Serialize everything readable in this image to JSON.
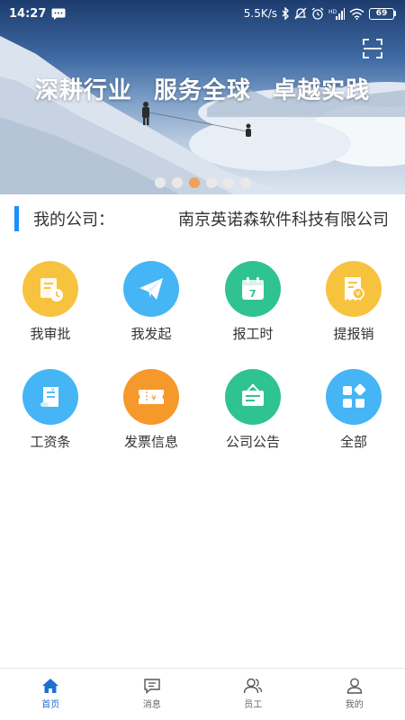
{
  "status_bar": {
    "time": "14:27",
    "net_speed": "5.5K/s",
    "battery": "69",
    "icons": [
      "message-icon",
      "bluetooth-icon",
      "mute-icon",
      "alarm-icon",
      "signal-icon",
      "wifi-icon",
      "battery-icon"
    ]
  },
  "banner": {
    "slogan": [
      "深耕行业",
      "服务全球",
      "卓越实践"
    ],
    "scan_icon": "scan-icon",
    "dot_count": 6,
    "active_dot": 2,
    "colors": {
      "active_dot": "#f2a154",
      "inactive_dot": "#e9e9e9"
    }
  },
  "company": {
    "label": "我的公司：",
    "name": "南京英诺森软件科技有限公司",
    "accent": "#1890ff"
  },
  "grid": [
    {
      "label": "我审批",
      "icon": "approval-stamp-icon",
      "color": "#f7c33f"
    },
    {
      "label": "我发起",
      "icon": "paper-plane-icon",
      "color": "#45b5f5"
    },
    {
      "label": "报工时",
      "icon": "calendar-icon",
      "color": "#2fc392"
    },
    {
      "label": "提报销",
      "icon": "receipt-yuan-icon",
      "color": "#f7c33f"
    },
    {
      "label": "工资条",
      "icon": "payslip-scroll-icon",
      "color": "#45b5f5"
    },
    {
      "label": "发票信息",
      "icon": "invoice-ticket-icon",
      "color": "#f5992a"
    },
    {
      "label": "公司公告",
      "icon": "notice-board-icon",
      "color": "#2fc392"
    },
    {
      "label": "全部",
      "icon": "all-apps-icon",
      "color": "#45b5f5"
    }
  ],
  "bottom_nav": [
    {
      "label": "首页",
      "icon": "home-icon",
      "active": true
    },
    {
      "label": "消息",
      "icon": "message-icon",
      "active": false
    },
    {
      "label": "员工",
      "icon": "employees-icon",
      "active": false
    },
    {
      "label": "我的",
      "icon": "profile-icon",
      "active": false
    }
  ],
  "colors": {
    "nav_active": "#1f6fd1",
    "nav_inactive": "#666666"
  }
}
